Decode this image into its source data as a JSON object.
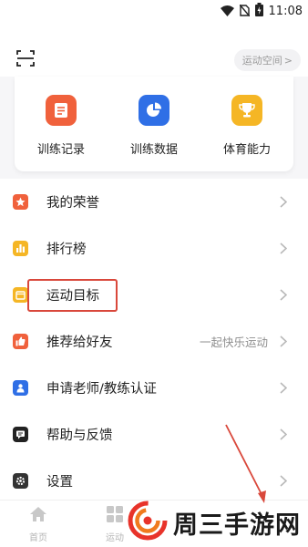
{
  "status_bar": {
    "time": "11:08",
    "icons": [
      "wifi-icon",
      "no-sim-icon",
      "battery-charging-icon"
    ]
  },
  "header": {
    "scan_icon": "scan-icon",
    "space_button_label": "运动空间",
    "space_button_chevron": ">"
  },
  "features": [
    {
      "label": "训练记录",
      "icon": "document-list-icon",
      "color": "#f0613c"
    },
    {
      "label": "训练数据",
      "icon": "pie-chart-icon",
      "color": "#2f6fe6"
    },
    {
      "label": "体育能力",
      "icon": "trophy-icon",
      "color": "#f5b625"
    }
  ],
  "menu": {
    "items": [
      {
        "label": "我的荣誉",
        "hint": "",
        "icon": "medal-icon",
        "color": "#f0613c"
      },
      {
        "label": "排行榜",
        "hint": "",
        "icon": "bar-chart-icon",
        "color": "#f5b625"
      },
      {
        "label": "运动目标",
        "hint": "",
        "icon": "target-icon",
        "color": "#f5b625",
        "highlighted": true
      },
      {
        "label": "推荐给好友",
        "hint": "一起快乐运动",
        "icon": "thumbs-up-icon",
        "color": "#f0613c"
      },
      {
        "label": "申请老师/教练认证",
        "hint": "",
        "icon": "badge-icon",
        "color": "#2f6fe6"
      },
      {
        "label": "帮助与反馈",
        "hint": "",
        "icon": "chat-icon",
        "color": "#222222"
      },
      {
        "label": "设置",
        "hint": "",
        "icon": "gear-icon",
        "color": "#333333"
      }
    ]
  },
  "tabbar": {
    "tabs": [
      {
        "label": "首页",
        "icon": "home-icon"
      },
      {
        "label": "运动",
        "icon": "grid-icon"
      }
    ]
  },
  "watermark": {
    "text": "周三手游网",
    "logo_colors": [
      "#e8332a",
      "#f07a1e"
    ]
  },
  "annotation": {
    "highlight_color": "#d9483b",
    "arrow_color": "#d9483b"
  }
}
